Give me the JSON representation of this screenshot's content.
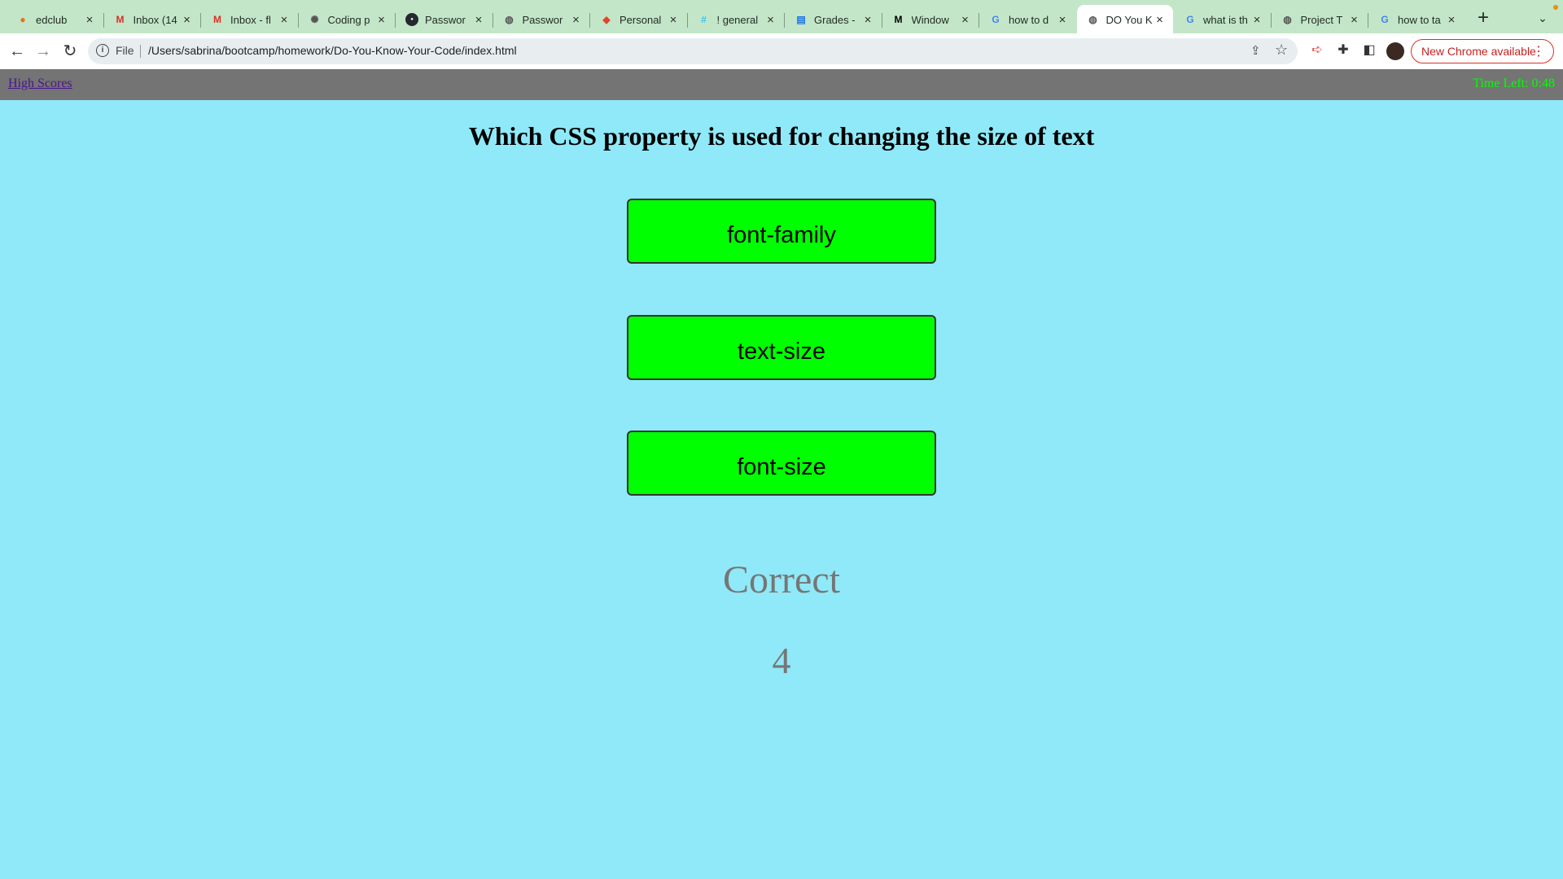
{
  "browser": {
    "tabs": [
      {
        "title": "edclub",
        "icon": "edclub-icon",
        "glyph": "●",
        "color": "#e8711a"
      },
      {
        "title": "Inbox (14",
        "icon": "gmail-icon",
        "glyph": "M",
        "color": "#d93025"
      },
      {
        "title": "Inbox - fl",
        "icon": "gmail-icon",
        "glyph": "M",
        "color": "#d93025"
      },
      {
        "title": "Coding p",
        "icon": "openai-icon",
        "glyph": "✺",
        "color": "#555555"
      },
      {
        "title": "Passwor",
        "icon": "github-icon",
        "glyph": "●",
        "color": "#ffffff"
      },
      {
        "title": "Passwor",
        "icon": "globe-icon",
        "glyph": "◍",
        "color": "#555555"
      },
      {
        "title": "Personal",
        "icon": "gitlab-icon",
        "glyph": "◆",
        "color": "#e24329"
      },
      {
        "title": "! general",
        "icon": "slack-icon",
        "glyph": "#",
        "color": "#36c5f0"
      },
      {
        "title": "Grades -",
        "icon": "document-icon",
        "glyph": "▤",
        "color": "#1a73e8"
      },
      {
        "title": "Window",
        "icon": "medium-icon",
        "glyph": "M",
        "color": "#000000"
      },
      {
        "title": "how to d",
        "icon": "google-icon",
        "glyph": "G",
        "color": "#4285f4"
      },
      {
        "title": "DO You K",
        "icon": "globe-icon",
        "glyph": "◍",
        "color": "#555555"
      },
      {
        "title": "what is th",
        "icon": "google-icon",
        "glyph": "G",
        "color": "#4285f4"
      },
      {
        "title": "Project T",
        "icon": "globe-icon",
        "glyph": "◍",
        "color": "#555555"
      },
      {
        "title": "how to ta",
        "icon": "google-icon",
        "glyph": "G",
        "color": "#4285f4"
      }
    ],
    "active_tab": 11,
    "url_scheme": "File",
    "url": "/Users/sabrina/bootcamp/homework/Do-You-Know-Your-Code/index.html",
    "update_label": "New Chrome available"
  },
  "quiz": {
    "high_scores_label": "High Scores",
    "timer": "Time Left: 0:48",
    "question": "Which CSS property is used for changing the size of text",
    "choices": [
      "font-family",
      "text-size",
      "font-size"
    ],
    "feedback": "Correct",
    "score": "4"
  },
  "colors": {
    "page_bg": "#8fe9f8",
    "header_bg": "#747474",
    "choice_bg": "#00ff00",
    "timer": "#00ff00",
    "feedback_text": "#767676"
  }
}
